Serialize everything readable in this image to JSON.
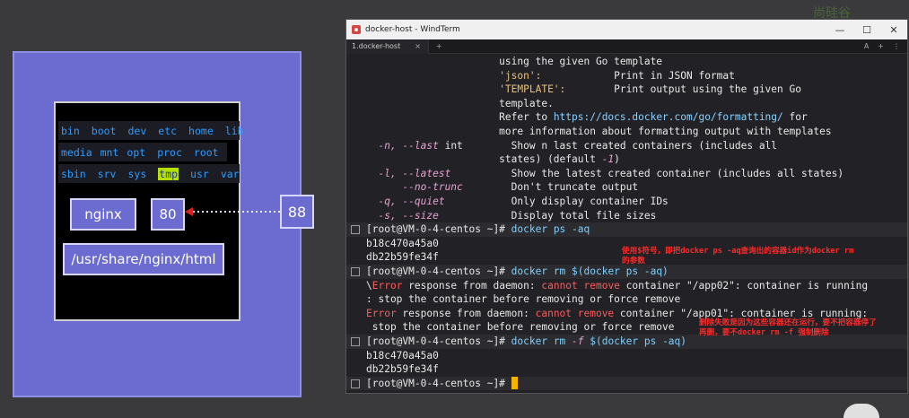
{
  "diagram": {
    "fs_rows": [
      [
        "bin",
        "boot",
        "dev",
        "etc",
        "home",
        "lib"
      ],
      [
        "media",
        "mnt",
        "opt",
        "proc",
        "root"
      ],
      [
        "sbin",
        "srv",
        "sys",
        "tmp",
        "usr",
        "var"
      ]
    ],
    "container_name": "nginx",
    "container_port": "80",
    "host_port": "88",
    "volume_path": "/usr/share/nginx/html"
  },
  "window": {
    "title": "docker-host - WindTerm",
    "tab_label": "1.docker-host",
    "tab_close": "×",
    "tab_add": "+",
    "tab_a": "A",
    "tab_menu": "⋮",
    "controls": [
      "—",
      "☐",
      "✕"
    ]
  },
  "terminal": {
    "prompt": "[root@VM-0-4-centos ~]#",
    "cmd1": "docker ps -aq",
    "cmd2_a": "docker rm $(docker ps -aq)",
    "cmd3_a": "docker rm ",
    "cmd3_flag": "-f",
    "cmd3_b": " $(docker ps -aq)",
    "id1": "b18c470a45a0",
    "id2": "db22b59fe34f",
    "help": {
      "l1": "                      using the given Go template",
      "l2_a": "                      ",
      "l2_b": "'json':",
      "l2_c": "            Print in JSON format",
      "l3_a": "                      ",
      "l3_b": "'TEMPLATE':",
      "l3_c": "        Print output using the given Go",
      "l4": "                      template.",
      "l5_a": "                      Refer to ",
      "l5_b": "https://docs.docker.com/go/formatting/",
      "l5_c": " for",
      "l6": "                      more information about formatting output with templates",
      "l7_a": "  ",
      "l7_b": "-n, --last",
      "l7_c": " int        Show n last created containers (includes all",
      "l8_a": "                      states) (default ",
      "l8_b": "-1",
      "l8_c": ")",
      "l9_a": "  ",
      "l9_b": "-l, --latest",
      "l9_c": "          Show the latest created container (includes all states)",
      "l10_a": "      ",
      "l10_b": "--no-trunc",
      "l10_c": "        Don't truncate output",
      "l11_a": "  ",
      "l11_b": "-q, --quiet",
      "l11_c": "           Only display container IDs",
      "l12_a": "  ",
      "l12_b": "-s, --size",
      "l12_c": "            Display total file sizes"
    },
    "err1_a": "\\",
    "err1_b": "Error",
    "err1_c": " response from daemon: ",
    "err1_d": "cannot remove",
    "err1_e": " container \"/app02\": container is running ",
    "err1_f": ": stop the container before removing or force remove",
    "err2_a": "Error",
    "err2_b": " response from daemon: ",
    "err2_c": "cannot remove",
    "err2_d": " container \"/app01\": container is running: ",
    "err2_e": " stop the container before removing or force remove"
  },
  "annotations": {
    "note1": "使用$符号，即把docker ps -aq查询出的容器id作为docker rm\n的参数",
    "note2": "删除失败是因为这些容器还在运行，要不把容器停了\n再删，要不docker rm -f 强制删除"
  },
  "logo_text": "尚硅谷"
}
